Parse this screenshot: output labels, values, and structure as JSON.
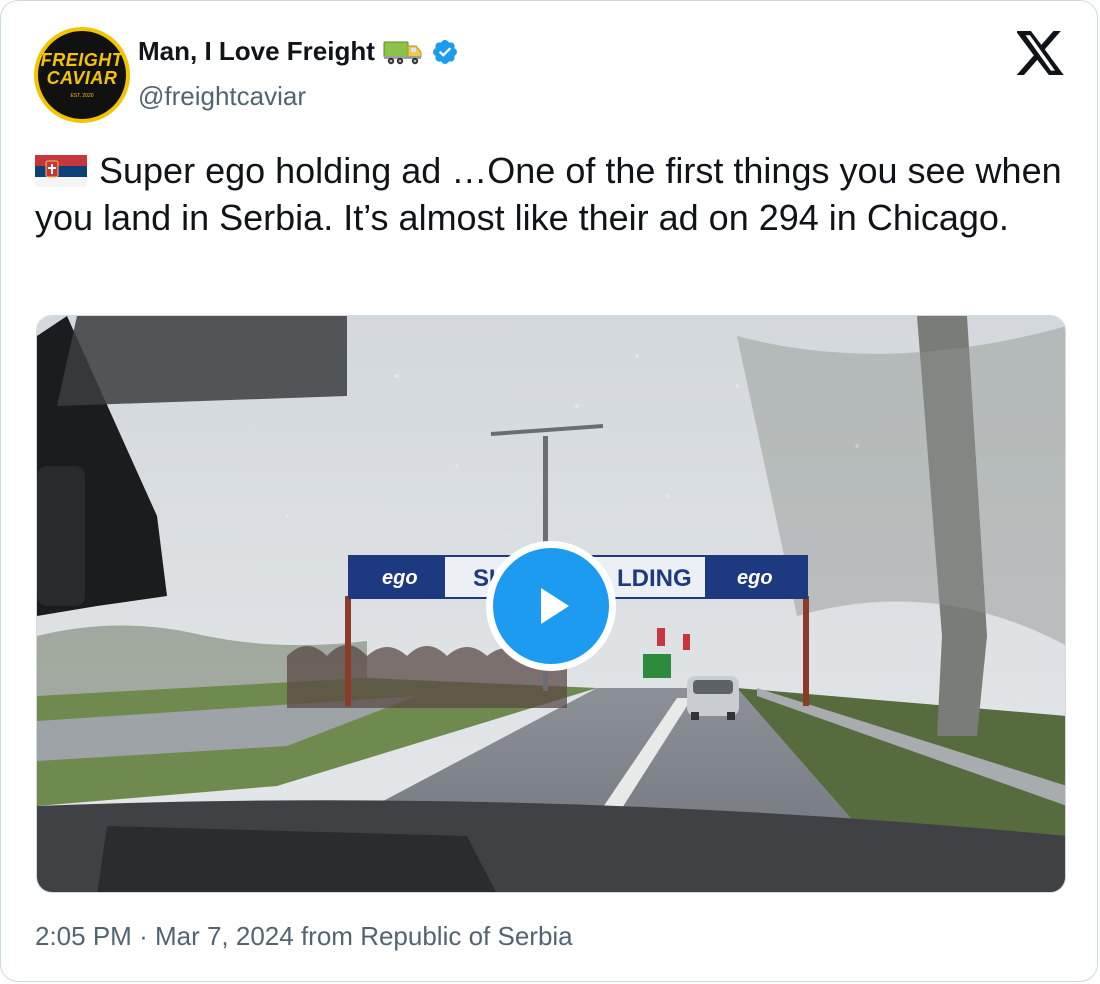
{
  "author": {
    "display_name": "Man, I Love Freight",
    "handle": "@freightcaviar",
    "avatar_text_line1": "FREIGHT",
    "avatar_text_line2": "CAVIAR",
    "avatar_small_text": "EST. 2020",
    "verified": true,
    "emoji_icon": "truck-icon"
  },
  "platform_icon": "x-logo-icon",
  "tweet": {
    "flag_icon": "serbia-flag-icon",
    "text": "Super ego holding ad …One of the first things you see when you land in Serbia. It’s almost like their ad on 294 in Chicago."
  },
  "media": {
    "type": "video",
    "play_icon": "play-icon",
    "scene_sign_left": "ego",
    "scene_sign_middle_left": "SU",
    "scene_sign_middle_right": "LDING",
    "scene_sign_right": "ego"
  },
  "footer": {
    "time": "2:05 PM",
    "separator": "·",
    "date": "Mar 7, 2024",
    "from_label": "from",
    "location": "Republic of Serbia"
  },
  "colors": {
    "accent": "#1d9bf0",
    "text_primary": "#0f1419",
    "text_secondary": "#536471",
    "border": "#cfd9de",
    "avatar_gold": "#f5c400"
  }
}
